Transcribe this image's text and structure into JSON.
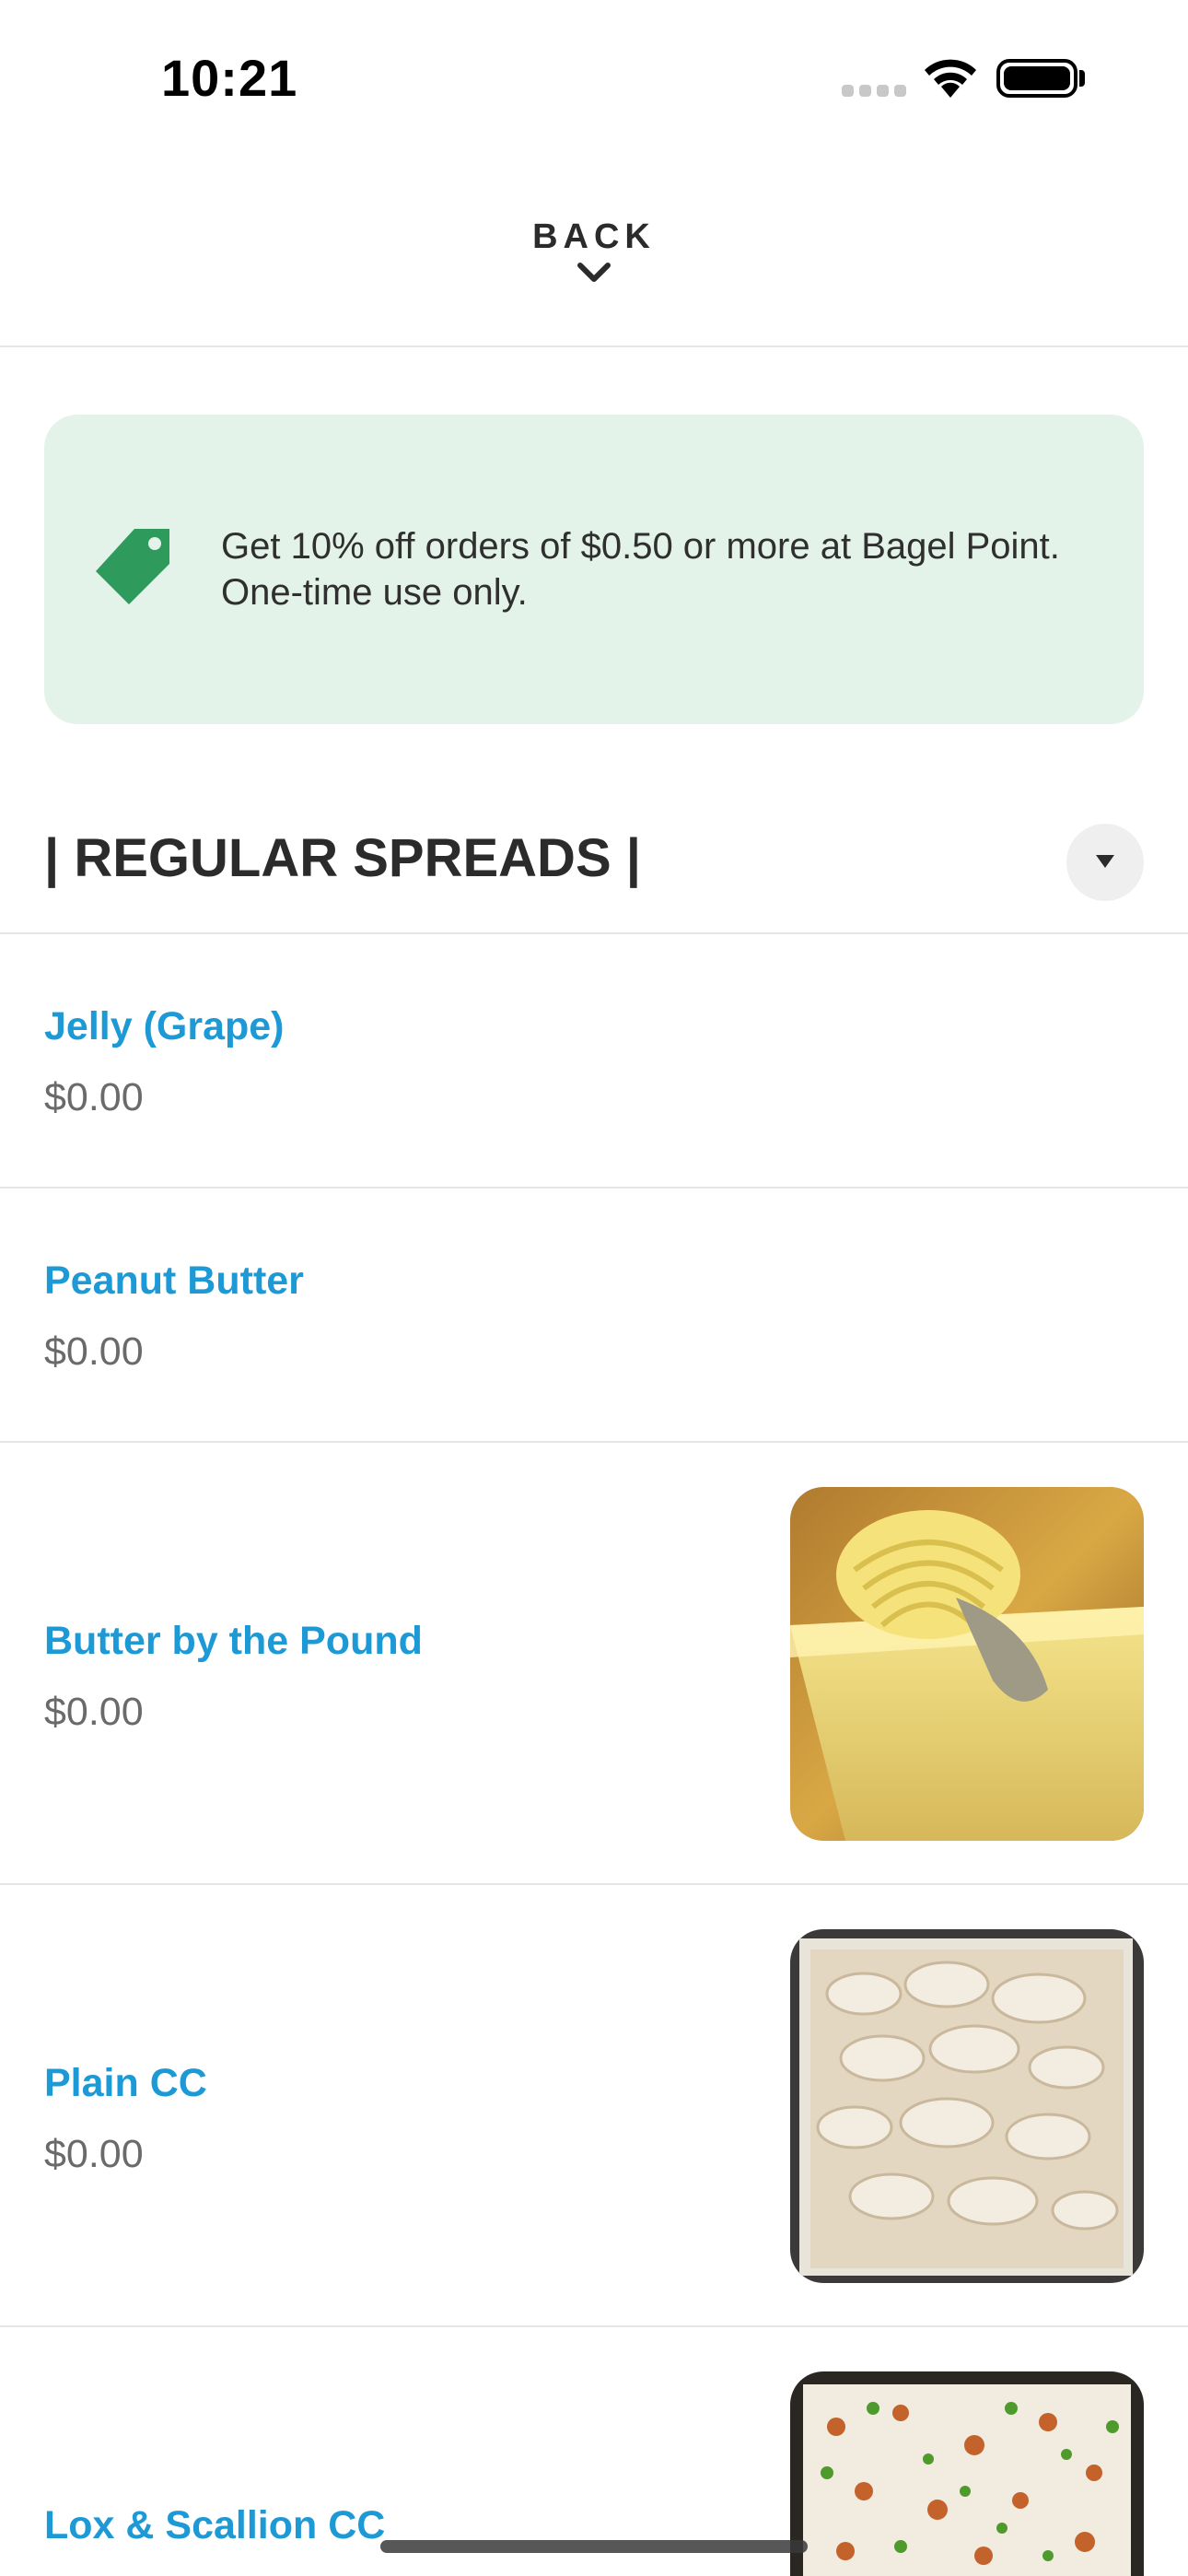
{
  "status_bar": {
    "time": "10:21"
  },
  "header": {
    "back_label": "BACK"
  },
  "promo": {
    "text": "Get 10% off orders of $0.50 or more at Bagel Point. One-time use only.",
    "accent_color": "#2e9a5c",
    "background_color": "#e3f3ea",
    "icon": "price-tag-icon"
  },
  "section": {
    "title": "| REGULAR SPREADS |",
    "toggle_icon": "caret-down-icon"
  },
  "items": [
    {
      "name": "Jelly (Grape)",
      "price": "$0.00"
    },
    {
      "name": "Peanut Butter",
      "price": "$0.00"
    },
    {
      "name": "Butter by the Pound",
      "price": "$0.00",
      "image": "butter-photo"
    },
    {
      "name": "Plain CC",
      "price": "$0.00",
      "image": "cream-cheese-photo"
    },
    {
      "name": "Lox & Scallion CC",
      "image": "lox-scallion-cream-cheese-photo"
    }
  ],
  "colors": {
    "link_blue": "#1d9ad6",
    "price_gray": "#6a6a6a",
    "divider": "#e6e6e6"
  }
}
